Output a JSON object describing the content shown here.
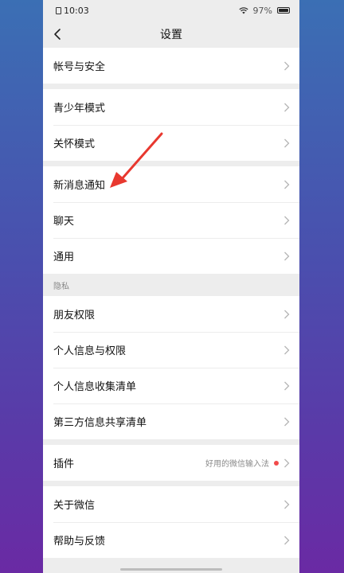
{
  "status_bar": {
    "time": "10:03",
    "battery": "97%"
  },
  "nav": {
    "title": "设置"
  },
  "sections": {
    "account": {
      "label": "帐号与安全"
    },
    "youth": {
      "label": "青少年模式"
    },
    "care": {
      "label": "关怀模式"
    },
    "notify": {
      "label": "新消息通知"
    },
    "chat": {
      "label": "聊天"
    },
    "general": {
      "label": "通用"
    },
    "privacy_header": "隐私",
    "friends": {
      "label": "朋友权限"
    },
    "personal": {
      "label": "个人信息与权限"
    },
    "collect": {
      "label": "个人信息收集清单"
    },
    "thirdparty": {
      "label": "第三方信息共享清单"
    },
    "plugins": {
      "label": "插件",
      "extra": "好用的微信输入法"
    },
    "about": {
      "label": "关于微信"
    },
    "help": {
      "label": "帮助与反馈"
    }
  },
  "colors": {
    "arrow": "#e8382f",
    "dot": "#f24b4b"
  }
}
